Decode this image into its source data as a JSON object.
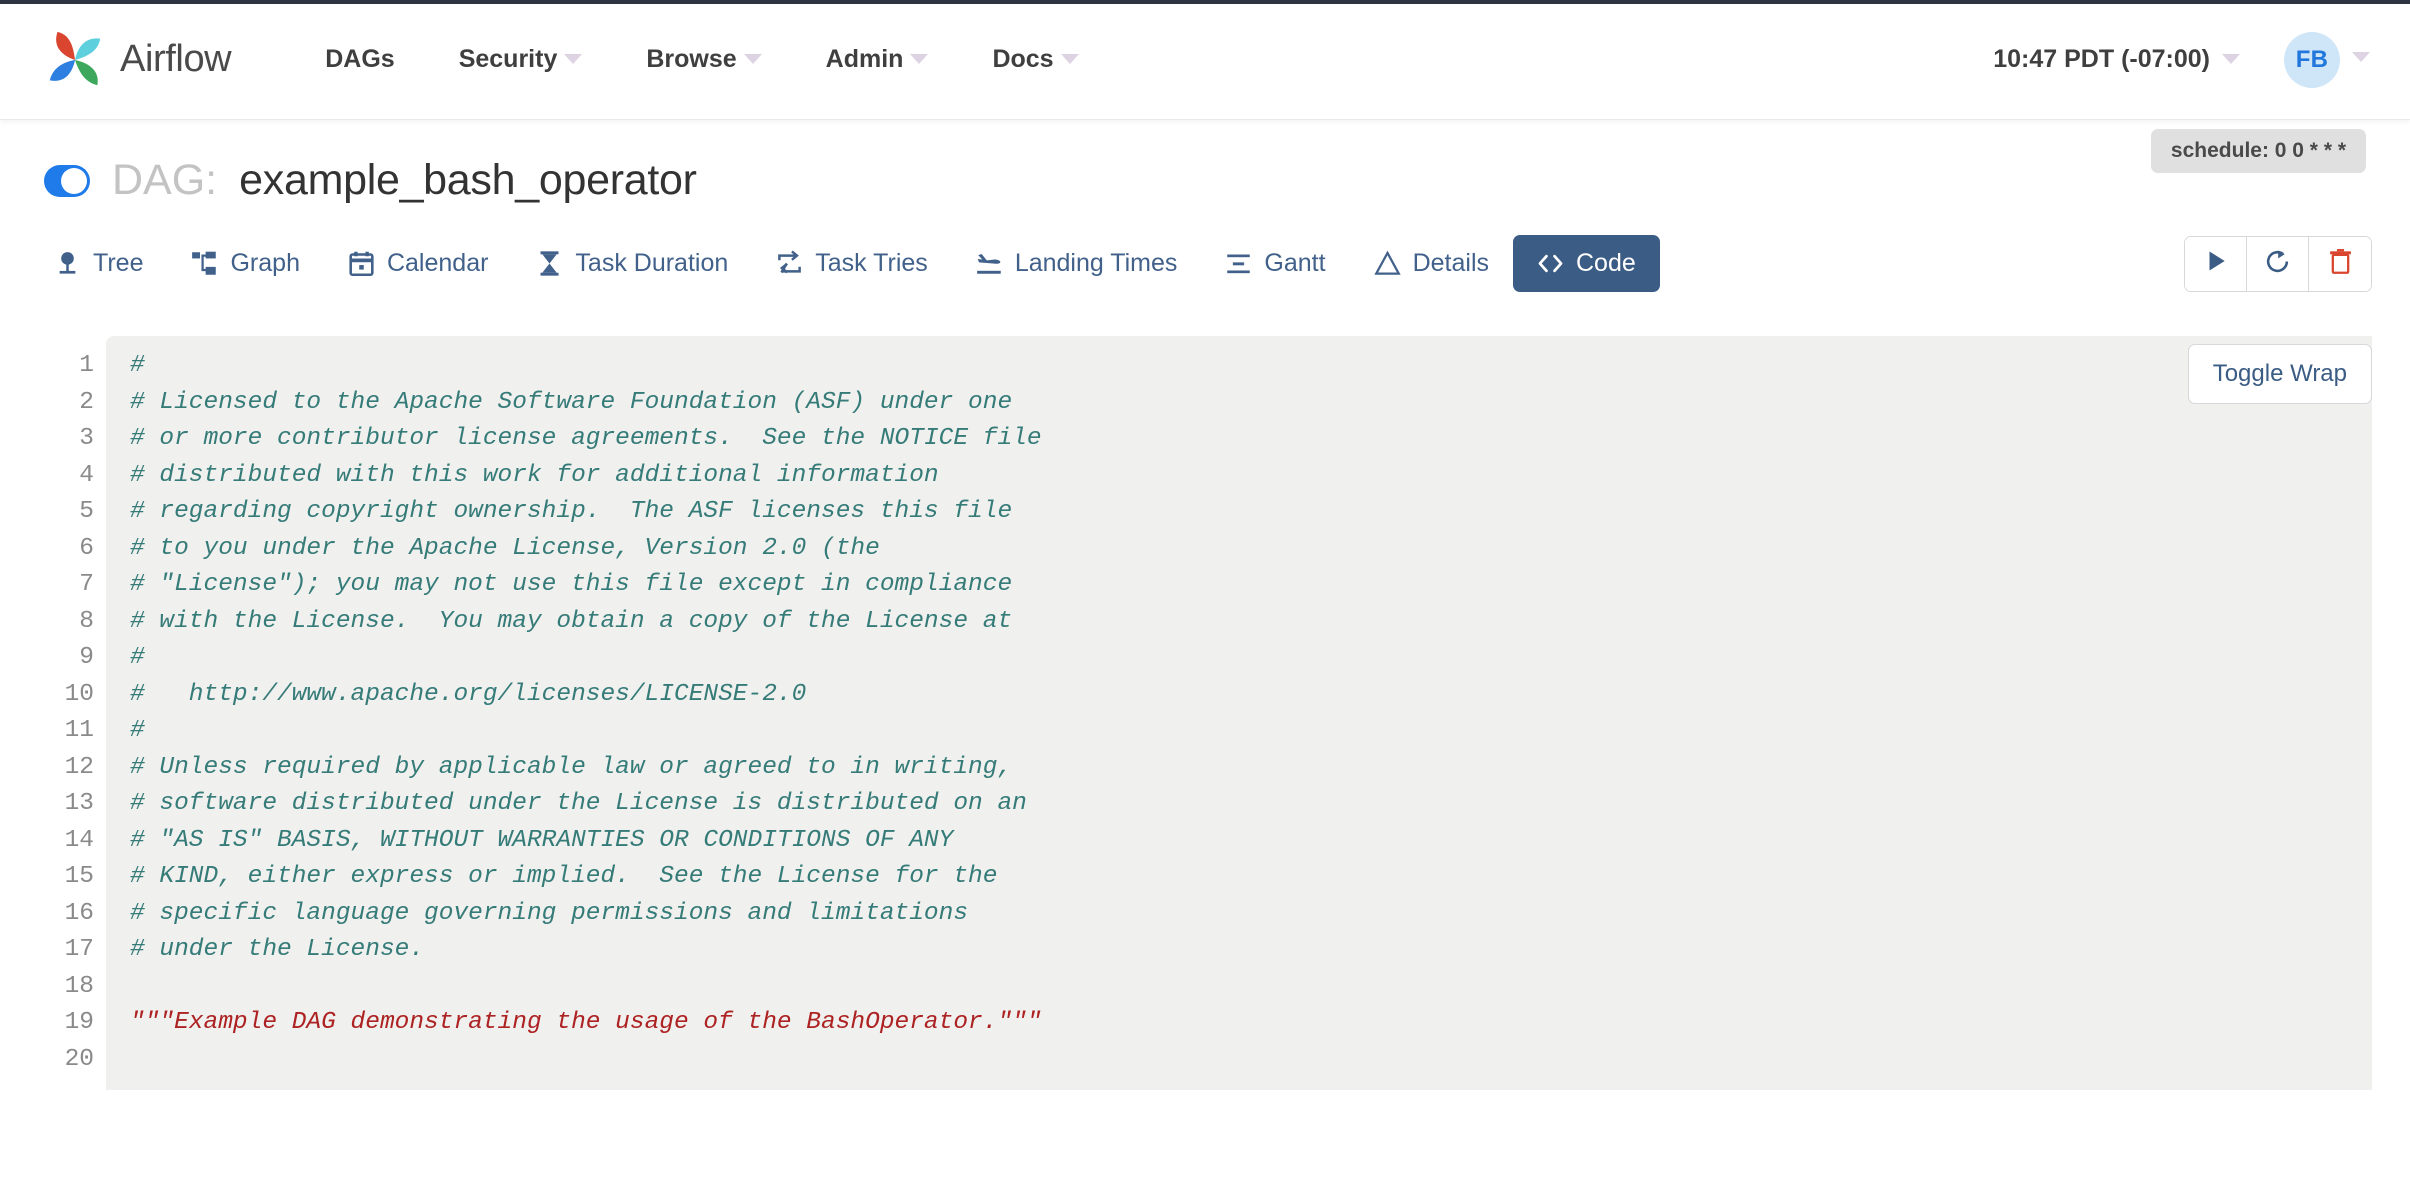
{
  "navbar": {
    "brand": "Airflow",
    "logo_icon": "airflow-pinwheel-logo",
    "links": [
      {
        "label": "DAGs",
        "has_caret": false
      },
      {
        "label": "Security",
        "has_caret": true
      },
      {
        "label": "Browse",
        "has_caret": true
      },
      {
        "label": "Admin",
        "has_caret": true
      },
      {
        "label": "Docs",
        "has_caret": true
      }
    ],
    "clock": "10:47 PDT (-07:00)",
    "user_initials": "FB"
  },
  "dag": {
    "toggle_state": "on",
    "label": "DAG:",
    "name": "example_bash_operator",
    "schedule_badge": "schedule: 0 0 * * *"
  },
  "tabs": [
    {
      "label": "Tree",
      "icon": "tree-icon",
      "active": false
    },
    {
      "label": "Graph",
      "icon": "project-diagram-icon",
      "active": false
    },
    {
      "label": "Calendar",
      "icon": "calendar-icon",
      "active": false
    },
    {
      "label": "Task Duration",
      "icon": "hourglass-icon",
      "active": false
    },
    {
      "label": "Task Tries",
      "icon": "retry-arrows-icon",
      "active": false
    },
    {
      "label": "Landing Times",
      "icon": "plane-landing-icon",
      "active": false
    },
    {
      "label": "Gantt",
      "icon": "gantt-bars-icon",
      "active": false
    },
    {
      "label": "Details",
      "icon": "triangle-info-icon",
      "active": false
    },
    {
      "label": "Code",
      "icon": "code-brackets-icon",
      "active": true
    }
  ],
  "actions": [
    {
      "name": "trigger-dag-button",
      "icon": "play-icon",
      "color": "#3b5c84"
    },
    {
      "name": "refresh-button",
      "icon": "refresh-icon",
      "color": "#3b5c84"
    },
    {
      "name": "delete-dag-button",
      "icon": "trash-icon",
      "color": "#d9452f"
    }
  ],
  "code_panel": {
    "toggle_wrap_label": "Toggle Wrap",
    "line_numbers": "1\n2\n3\n4\n5\n6\n7\n8\n9\n10\n11\n12\n13\n14\n15\n16\n17\n18\n19\n20",
    "lines": [
      {
        "n": 1,
        "text": "#",
        "type": "comment"
      },
      {
        "n": 2,
        "text": "# Licensed to the Apache Software Foundation (ASF) under one",
        "type": "comment"
      },
      {
        "n": 3,
        "text": "# or more contributor license agreements.  See the NOTICE file",
        "type": "comment"
      },
      {
        "n": 4,
        "text": "# distributed with this work for additional information",
        "type": "comment"
      },
      {
        "n": 5,
        "text": "# regarding copyright ownership.  The ASF licenses this file",
        "type": "comment"
      },
      {
        "n": 6,
        "text": "# to you under the Apache License, Version 2.0 (the",
        "type": "comment"
      },
      {
        "n": 7,
        "text": "# \"License\"); you may not use this file except in compliance",
        "type": "comment"
      },
      {
        "n": 8,
        "text": "# with the License.  You may obtain a copy of the License at",
        "type": "comment"
      },
      {
        "n": 9,
        "text": "#",
        "type": "comment"
      },
      {
        "n": 10,
        "text": "#   http://www.apache.org/licenses/LICENSE-2.0",
        "type": "comment"
      },
      {
        "n": 11,
        "text": "#",
        "type": "comment"
      },
      {
        "n": 12,
        "text": "# Unless required by applicable law or agreed to in writing,",
        "type": "comment"
      },
      {
        "n": 13,
        "text": "# software distributed under the License is distributed on an",
        "type": "comment"
      },
      {
        "n": 14,
        "text": "# \"AS IS\" BASIS, WITHOUT WARRANTIES OR CONDITIONS OF ANY",
        "type": "comment"
      },
      {
        "n": 15,
        "text": "# KIND, either express or implied.  See the License for the",
        "type": "comment"
      },
      {
        "n": 16,
        "text": "# specific language governing permissions and limitations",
        "type": "comment"
      },
      {
        "n": 17,
        "text": "# under the License.",
        "type": "comment"
      },
      {
        "n": 18,
        "text": "",
        "type": "blank"
      },
      {
        "n": 19,
        "text": "\"\"\"Example DAG demonstrating the usage of the BashOperator.\"\"\"",
        "type": "string"
      },
      {
        "n": 20,
        "text": "",
        "type": "blank"
      }
    ]
  },
  "colors": {
    "accent_blue": "#3b5c84",
    "toggle_on": "#1f7aea",
    "danger_red": "#d9452f",
    "comment_teal": "#357b78",
    "string_red": "#ad2222",
    "code_bg": "#f0f0ef",
    "navbar_top_rule": "#2e3440"
  }
}
